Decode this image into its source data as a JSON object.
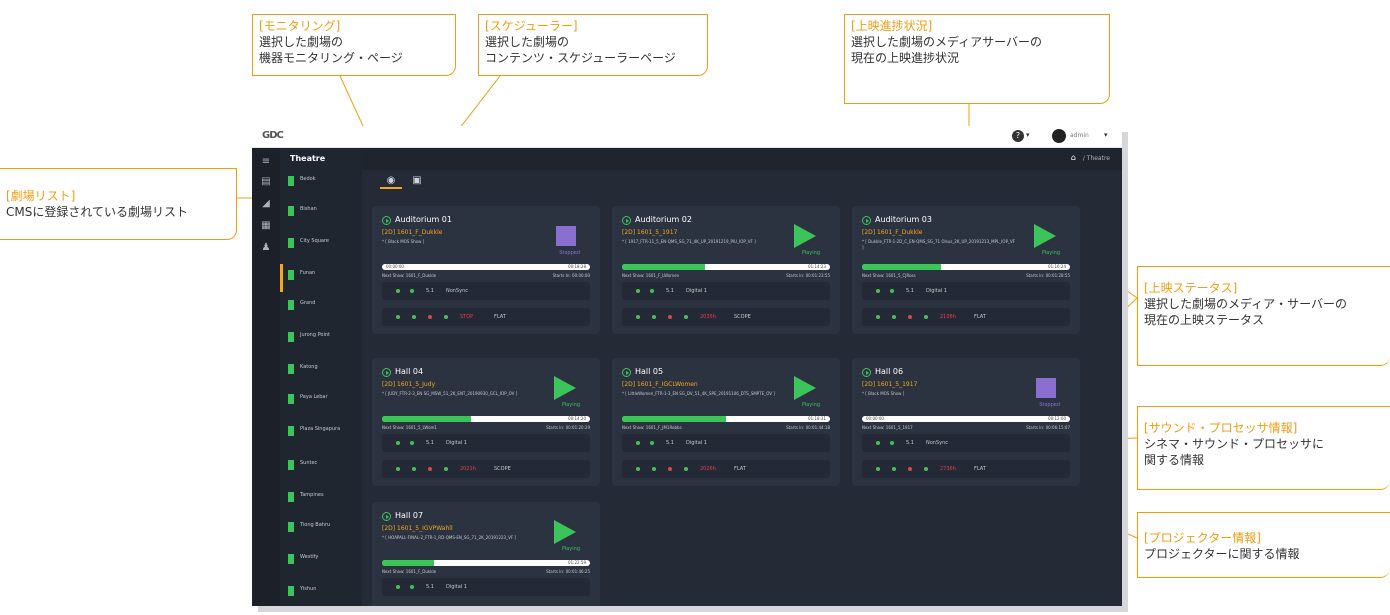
{
  "annotations": {
    "monitoring": {
      "title": "[モニタリング]",
      "desc": "選択した劇場の\n機器モニタリング・ページ"
    },
    "scheduler": {
      "title": "[スケジューラー]",
      "desc": "選択した劇場の\nコンテンツ・スケジューラーページ"
    },
    "progress": {
      "title": "[上映進捗状況]",
      "desc": "選択した劇場のメディアサーバーの\n現在の上映進捗状況"
    },
    "theatre_list": {
      "title": "[劇場リスト]",
      "desc": "CMSに登録されている劇場リスト"
    },
    "status": {
      "title": "[上映ステータス]",
      "desc": "選択した劇場のメディア・サーバーの\n現在の上映ステータス"
    },
    "sound": {
      "title": "[サウンド・プロセッサ情報]",
      "desc": "シネマ・サウンド・プロセッサに\n関する情報"
    },
    "projector": {
      "title": "[プロジェクター情報]",
      "desc": "プロジェクターに関する情報"
    }
  },
  "app": {
    "logo": "GDC",
    "user": "admin",
    "sidebar_title": "Theatre",
    "breadcrumb": "/ Theatre",
    "theatres": [
      "Bedok",
      "Bishan",
      "City Square",
      "Funan",
      "Grand",
      "Jurong Point",
      "Katong",
      "Paya Lebar",
      "Plaza Singapura",
      "Suntec",
      "Tampines",
      "Tiong Bahru",
      "Westify",
      "Yishun"
    ],
    "active_theatre": 3
  },
  "cards": [
    {
      "name": "Auditorium 01",
      "cpl": "[2D] 1601_F_Dukkle",
      "desc": "* [ Black MOS Show ]",
      "status": "Stopped",
      "progress": 0.0,
      "time_left": "00:00:00",
      "time_right": "00:18:28",
      "next": "Next Show: 1601_F_Dukkle",
      "start": "Starts In: 00:00:00",
      "sound_fmt": "5.1",
      "sound_input": "NonSync",
      "proj_status": "STOP",
      "proj_format": "FLAT",
      "proj_red": true
    },
    {
      "name": "Auditorium 02",
      "cpl": "[2D] 1601_5_1917",
      "desc": "* [ 1917_FTR-11_5_EN-QMS_SG_71_4K_UP_20191219_PIU_IOP_VF ]",
      "status": "Playing",
      "progress": 0.4,
      "time_left": "",
      "time_right": "01:14:23",
      "next": "Next Show: 1601_F_LWomen",
      "start": "Starts In: 00:01:23:55",
      "sound_fmt": "5.1",
      "sound_input": "Digital 1",
      "proj_status": "2035h",
      "proj_format": "SCOPE",
      "proj_red": false
    },
    {
      "name": "Auditorium 03",
      "cpl": "[2D] 1601_F_Dukkle",
      "desc": "* [ Dukkle_FTR-1-2D_C_EN-QMS_SG_71 Olsus_2K_UP_20191213_MPL_IOP_VF ]",
      "status": "Playing",
      "progress": 0.38,
      "time_left": "",
      "time_right": "01:16:24",
      "next": "Next Show: 1601_5_CJRoss",
      "start": "Starts In: 00:01:28:55",
      "sound_fmt": "5.1",
      "sound_input": "Digital 1",
      "proj_status": "2108h",
      "proj_format": "FLAT",
      "proj_red": false
    },
    {
      "name": "Hall 04",
      "cpl": "[2D] 1601_5_Judy",
      "desc": "* [ JUDY_FTR-2-3_EN SG_MSW_51_2K_ENT_20190930_GCL_IOP_OV ]",
      "status": "Playing",
      "progress": 0.43,
      "time_left": "",
      "time_right": "00:14:20",
      "next": "Next Show: 1601_5_LWom1",
      "start": "Starts In: 00:01:20:29",
      "sound_fmt": "5.1",
      "sound_input": "Digital 1",
      "proj_status": "2021h",
      "proj_format": "SCOPE",
      "proj_red": false
    },
    {
      "name": "Hall 05",
      "cpl": "[2D] 1601_F_IGCLWomen",
      "desc": "* [ LittleWomen_FTR-1-3_EN SG_DV_51_4K_SPE_20191106_DTS_SMPTE_OV ]",
      "status": "Playing",
      "progress": 0.5,
      "time_left": "",
      "time_right": "01:18:31",
      "next": "Next Show: 1601_F_JM1Robbs",
      "start": "Starts In: 00:01:44:18",
      "sound_fmt": "5.1",
      "sound_input": "Digital 1",
      "proj_status": "2026h",
      "proj_format": "FLAT",
      "proj_red": false
    },
    {
      "name": "Hall 06",
      "cpl": "[2D] 1601_5_1917",
      "desc": "* [ Black MOS Show ]",
      "status": "Stopped",
      "progress": 0.0,
      "time_left": "00:00:00",
      "time_right": "00:12:00",
      "next": "Next Show: 1601_5_1917",
      "start": "Starts In: 00:06:15:07",
      "sound_fmt": "5.1",
      "sound_input": "NonSync",
      "proj_status": "2736h",
      "proj_format": "FLAT",
      "proj_red": true
    },
    {
      "name": "Hall 07",
      "cpl": "[2D] 1601_5_IGVPWahll",
      "desc": "* [ HOAPALL-FINAL-2_FTR-1_RD-QMS-EN_SG_71_2K_20191223_VF ]",
      "status": "Playing",
      "progress": 0.25,
      "time_left": "",
      "time_right": "01:22:59",
      "next": "Next Show: 1601_F_Dukkle",
      "start": "Starts In: 00:01:46:25",
      "sound_fmt": "5.1",
      "sound_input": "Digital 1",
      "proj_status": "",
      "proj_format": "",
      "proj_red": false
    }
  ]
}
